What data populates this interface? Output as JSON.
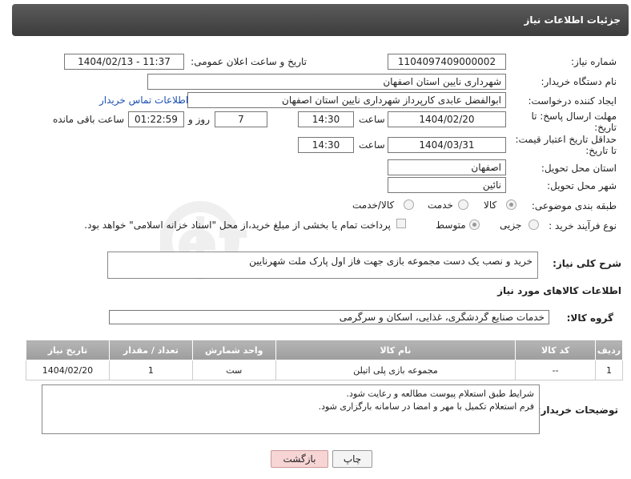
{
  "header": {
    "title": "جزئیات اطلاعات نیاز"
  },
  "form": {
    "need_number_label": "شماره نیاز:",
    "need_number": "1104097409000002",
    "announce_label": "تاریخ و ساعت اعلان عمومی:",
    "announce_value": "1404/02/13 - 11:37",
    "buyer_org_label": "نام دستگاه خریدار:",
    "buyer_org": "شهرداری نایین استان اصفهان",
    "creator_label": "ایجاد کننده درخواست:",
    "creator": "ابوالفضل عابدی کارپرداز شهرداری نایین استان اصفهان",
    "contact_link": "اطلاعات تماس خریدار",
    "deadline_label_1": "مهلت ارسال پاسخ: تا",
    "deadline_label_2": "تاریخ:",
    "deadline_date": "1404/02/20",
    "time_label": "ساعت",
    "deadline_time": "14:30",
    "days_value": "7",
    "days_label": "روز و",
    "remaining_value": "01:22:59",
    "remaining_label": "ساعت باقی مانده",
    "validity_label_1": "حداقل تاریخ اعتبار قیمت:",
    "validity_label_2": "تا تاریخ:",
    "validity_date": "1404/03/31",
    "validity_time_label": "ساعت",
    "validity_time": "14:30",
    "province_label": "استان محل تحویل:",
    "province": "اصفهان",
    "city_label": "شهر محل تحویل:",
    "city": "نائین",
    "category_label": "طبقه بندی موضوعی:",
    "category_options": [
      "کالا",
      "خدمت",
      "کالا/خدمت"
    ],
    "category_selected": "کالا",
    "process_label": "نوع فرآیند خرید :",
    "process_options": [
      "جزیی",
      "متوسط"
    ],
    "process_selected": "متوسط",
    "payment_note": "پرداخت تمام یا بخشی از مبلغ خرید،از محل \"اسناد خزانه اسلامی\" خواهد بود."
  },
  "summary": {
    "label": "شرح کلی نیاز:",
    "text": "خرید و نصب یک دست مجموعه بازی جهت فاز اول پارک ملت شهرنایین"
  },
  "goods": {
    "section_title": "اطلاعات کالاهای مورد نیاز",
    "group_label": "گروه کالا:",
    "group_value": "خدمات صنایع گردشگری، غذایی، اسکان و سرگرمی",
    "table": {
      "headers": [
        "ردیف",
        "کد کالا",
        "نام کالا",
        "واحد شمارش",
        "تعداد / مقدار",
        "تاریخ نیاز"
      ],
      "rows": [
        [
          "1",
          "--",
          "مجموعه بازی پلی اتیلن",
          "ست",
          "1",
          "1404/02/20"
        ]
      ]
    }
  },
  "buyer_notes": {
    "label": "توضیحات خریدار:",
    "line1": "شرایط طبق استعلام پیوست مطالعه و رعایت شود.",
    "line2": "فرم استعلام تکمیل با مهر و امضا در سامانه بارگزاری شود."
  },
  "buttons": {
    "print": "چاپ",
    "back": "بازگشت"
  },
  "watermark": {
    "text": "AriaTender.net"
  },
  "colors": {
    "header_bg": "#4a4a4a",
    "link": "#1a4fb5",
    "back_button": "#f7d5d5"
  }
}
